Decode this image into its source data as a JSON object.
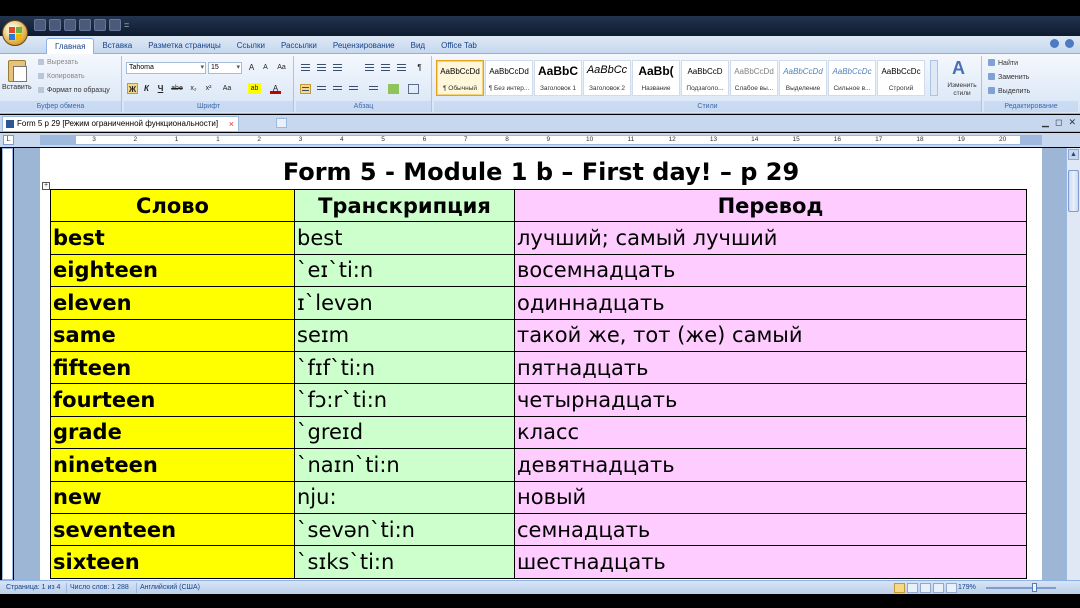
{
  "qat_sep": "=",
  "tabs": [
    "Главная",
    "Вставка",
    "Разметка страницы",
    "Ссылки",
    "Рассылки",
    "Рецензирование",
    "Вид",
    "Office Tab"
  ],
  "clipboard": {
    "paste": "Вставить",
    "cut": "Вырезать",
    "copy": "Копировать",
    "format_painter": "Формат по образцу",
    "group_label": "Буфер обмена"
  },
  "font": {
    "name": "Tahoma",
    "size": "15",
    "group_label": "Шрифт",
    "grow": "A",
    "shrink": "A",
    "clear": "Aa",
    "bold": "Ж",
    "italic": "К",
    "underline": "Ч",
    "strike": "abe",
    "sub": "x₂",
    "sup": "x²",
    "case": "Aa",
    "highlight": "ab",
    "color": "A"
  },
  "paragraph": {
    "group_label": "Абзац",
    "marks": "¶"
  },
  "styles": {
    "group_label": "Стили",
    "items": [
      {
        "sample": "AaBbCcDd",
        "name": "¶ Обычный"
      },
      {
        "sample": "AaBbCcDd",
        "name": "¶ Без интер..."
      },
      {
        "sample": "AaBbC",
        "name": "Заголовок 1"
      },
      {
        "sample": "AaBbCc",
        "name": "Заголовок 2"
      },
      {
        "sample": "AaBb(",
        "name": "Название"
      },
      {
        "sample": "AaBbCcD",
        "name": "Подзаголо..."
      },
      {
        "sample": "AaBbCcDd",
        "name": "Слабое вы..."
      },
      {
        "sample": "AaBbCcDd",
        "name": "Выделение"
      },
      {
        "sample": "AaBbCcDc",
        "name": "Сильное в..."
      },
      {
        "sample": "AaBbCcDc",
        "name": "Строгий"
      }
    ],
    "change_styles": "Изменить стили"
  },
  "editing": {
    "find": "Найти",
    "replace": "Заменить",
    "select": "Выделить",
    "group_label": "Редактирование"
  },
  "document_tab": {
    "label": "Form 5 p 29 [Режим ограниченной функциональности]",
    "close": "×"
  },
  "ruler": {
    "corner": "L",
    "numbers": [
      "3",
      "2",
      "1",
      "1",
      "2",
      "3",
      "4",
      "5",
      "6",
      "7",
      "8",
      "9",
      "10",
      "11",
      "12",
      "13",
      "14",
      "15",
      "16",
      "17",
      "18",
      "19",
      "20"
    ]
  },
  "document": {
    "title": "Form 5 - Module 1 b – First day! – p 29",
    "headers": [
      "Слово",
      "Транскрипция",
      "Перевод"
    ],
    "rows": [
      {
        "word": "best",
        "transcription": "best",
        "translation": "лучший; самый лучший"
      },
      {
        "word": "eighteen",
        "transcription": "ˋeɪˋti:n",
        "translation": "восемнадцать"
      },
      {
        "word": "eleven",
        "transcription": "ɪˋlevən",
        "translation": "одиннадцать"
      },
      {
        "word": "same",
        "transcription": "seɪm",
        "translation": "такой же, тот (же) самый"
      },
      {
        "word": "fifteen",
        "transcription": "ˋfɪfˋti:n",
        "translation": "пятнадцать"
      },
      {
        "word": "fourteen",
        "transcription": "ˋfɔ:rˋti:n",
        "translation": "четырнадцать"
      },
      {
        "word": "grade",
        "transcription": "ˋgreɪd",
        "translation": "класс"
      },
      {
        "word": "nineteen",
        "transcription": "ˋnaɪnˋti:n",
        "translation": "девятнадцать"
      },
      {
        "word": "new",
        "transcription": "nju:",
        "translation": "новый"
      },
      {
        "word": "seventeen",
        "transcription": "ˋsevənˋti:n",
        "translation": "семнадцать"
      },
      {
        "word": "sixteen",
        "transcription": "ˋsɪksˋti:n",
        "translation": "шестнадцать"
      }
    ]
  },
  "status": {
    "page": "Страница: 1 из 4",
    "words": "Число слов: 1 288",
    "language": "Английский (США)",
    "zoom": "179%"
  },
  "colors": {
    "word_column": "#ffff00",
    "transcription_column": "#ccffcc",
    "translation_column": "#ffccff"
  }
}
